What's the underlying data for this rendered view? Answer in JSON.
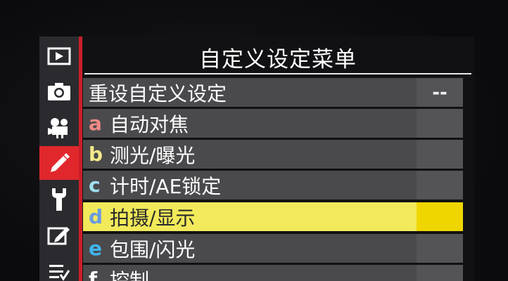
{
  "menu": {
    "title": "自定义设定菜单",
    "items": [
      {
        "letter": "",
        "label": "重设自定义设定",
        "value": "--"
      },
      {
        "letter": "a",
        "label": "自动对焦",
        "value": ""
      },
      {
        "letter": "b",
        "label": "测光/曝光",
        "value": ""
      },
      {
        "letter": "c",
        "label": "计时/AE锁定",
        "value": ""
      },
      {
        "letter": "d",
        "label": "拍摄/显示",
        "value": ""
      },
      {
        "letter": "e",
        "label": "包围/闪光",
        "value": ""
      },
      {
        "letter": "f",
        "label": "控制",
        "value": ""
      }
    ],
    "selected_index": 4
  },
  "tabs": [
    {
      "icon": "playback-icon"
    },
    {
      "icon": "camera-icon"
    },
    {
      "icon": "movie-camera-icon"
    },
    {
      "icon": "pencil-icon"
    },
    {
      "icon": "wrench-icon"
    },
    {
      "icon": "retouch-icon"
    },
    {
      "icon": "my-menu-icon"
    }
  ],
  "colors": {
    "accent_red": "#e0282c",
    "selected_row": "#f2ea5a",
    "letter_a": "#f08a86",
    "letter_b": "#f4ea8a",
    "letter_c": "#9fe0f0",
    "letter_d": "#6a9adf",
    "letter_e": "#3fb6f0",
    "letter_f": "#ffffff"
  }
}
